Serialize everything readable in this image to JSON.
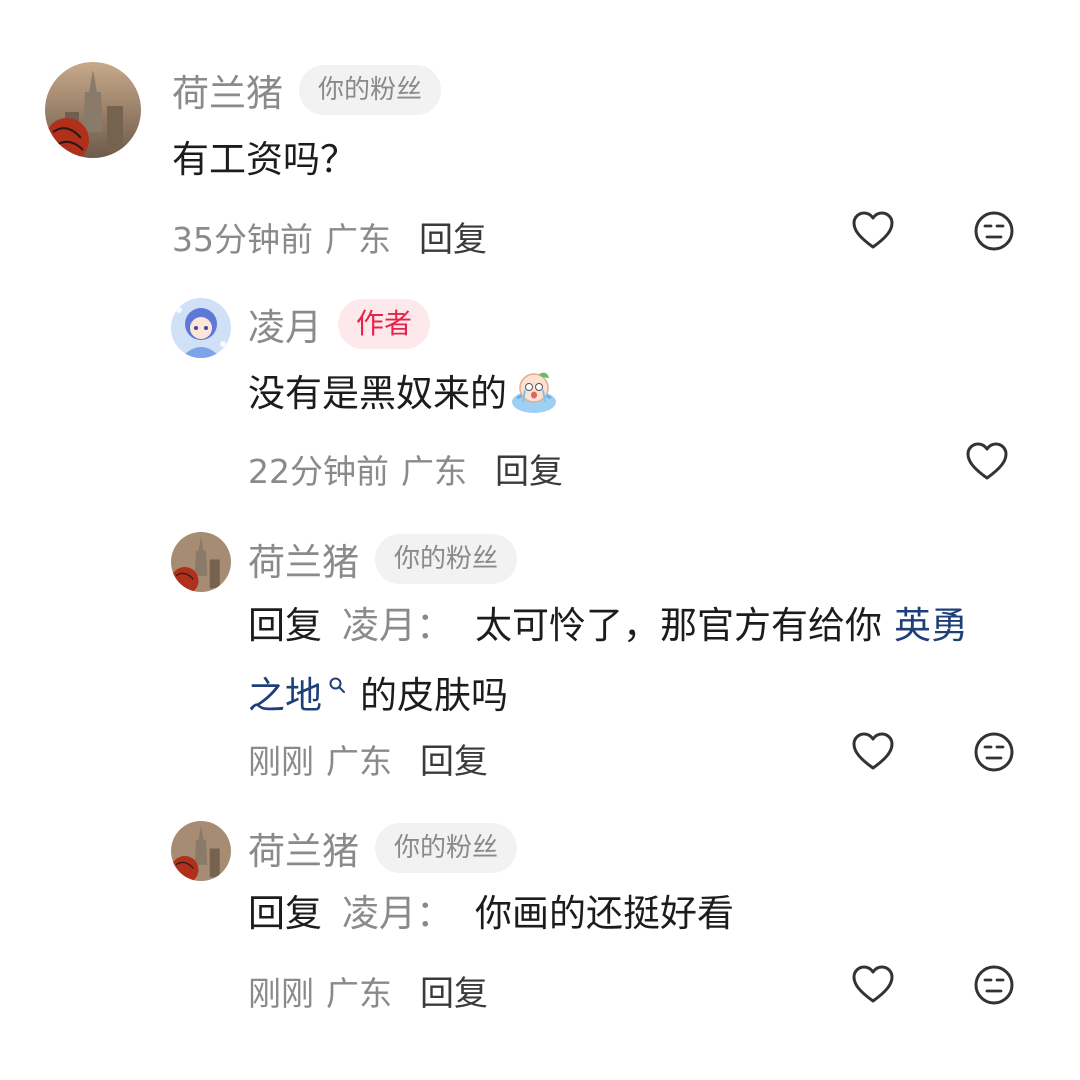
{
  "comments": [
    {
      "user": "荷兰猪",
      "badge": "你的粉丝",
      "text": "有工资吗？",
      "time": "35分钟前",
      "region": "广东",
      "reply_label": "回复"
    },
    {
      "user": "凌月",
      "badge": "作者",
      "text": "没有是黑奴来的",
      "time": "22分钟前",
      "region": "广东",
      "reply_label": "回复"
    },
    {
      "user": "荷兰猪",
      "badge": "你的粉丝",
      "reply_prefix": "回复",
      "reply_target": "凌月",
      "colon": "：",
      "text_part1": "太可怜了，那官方有给你",
      "link_line1": "英勇",
      "link_line2": "之地",
      "text_part2": "的皮肤吗",
      "time": "刚刚",
      "region": "广东",
      "reply_label": "回复"
    },
    {
      "user": "荷兰猪",
      "badge": "你的粉丝",
      "reply_prefix": "回复",
      "reply_target": "凌月",
      "colon": "：",
      "text": "你画的还挺好看",
      "time": "刚刚",
      "region": "广东",
      "reply_label": "回复"
    }
  ],
  "icons": {
    "like": "heart-outline-icon",
    "dislike": "meh-face-icon",
    "emoji": "crying-peach-emoji",
    "search": "search-icon"
  },
  "colors": {
    "author_badge": "#e8234a",
    "link": "#1f3f78",
    "muted": "#8a8a8a"
  }
}
